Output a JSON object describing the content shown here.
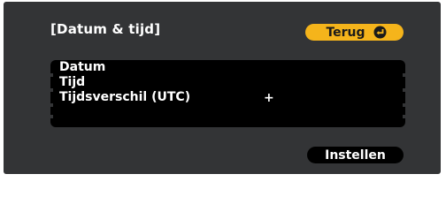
{
  "dialog": {
    "title": "[Datum & tijd]",
    "back_label": "Terug",
    "back_icon": "enter-icon",
    "set_label": "Instellen",
    "accent_color": "#f5b41b"
  },
  "menu": {
    "items": [
      {
        "label": "Datum"
      },
      {
        "label": "Tijd"
      },
      {
        "label": "Tijdsverschil (UTC)",
        "value": "+"
      }
    ]
  }
}
